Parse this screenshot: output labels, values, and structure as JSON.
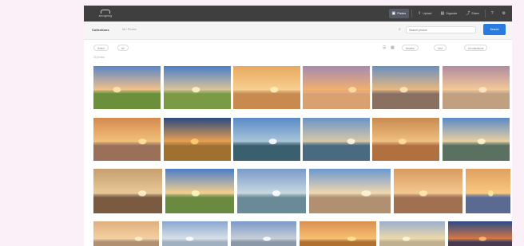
{
  "app": {
    "logo_text": "smugmug"
  },
  "nav": {
    "items": [
      {
        "label": "Photos",
        "icon": "image-icon",
        "active": true
      },
      {
        "label": "Upload",
        "icon": "upload-icon",
        "active": false
      },
      {
        "label": "Organize",
        "icon": "folder-icon",
        "active": false
      },
      {
        "label": "Share",
        "icon": "share-icon",
        "active": false
      }
    ]
  },
  "searchbar": {
    "collections_label": "Collections",
    "breadcrumb": "All / Photos",
    "search_placeholder": "Search photos",
    "search_button": "Search"
  },
  "toolbar": {
    "chip_left_1": "Select",
    "chip_left_2": "All",
    "sort_label": "Newest",
    "view_label": "Grid",
    "filter_label": "All collections"
  },
  "results": {
    "count_label": "24 photos"
  },
  "photos": [
    {
      "row": 1,
      "sky": "#5a86c8",
      "horizon": "#f2c089",
      "ground": "#6b8f3a",
      "sun": "#ffe9b0"
    },
    {
      "row": 1,
      "sky": "#4a7ec8",
      "horizon": "#d9c49a",
      "ground": "#7a9a45",
      "sun": "#fff4c8"
    },
    {
      "row": 1,
      "sky": "#e8a860",
      "horizon": "#f7d090",
      "ground": "#c98a50",
      "sun": "#fff0b8"
    },
    {
      "row": 1,
      "sky": "#a88ab0",
      "horizon": "#f0b070",
      "ground": "#d9a070",
      "sun": "#ffe0a8"
    },
    {
      "row": 1,
      "sky": "#6a90c0",
      "horizon": "#e8b880",
      "ground": "#8a7060",
      "sun": "#ffe8c0"
    },
    {
      "row": 1,
      "sky": "#b08ca0",
      "horizon": "#f4c898",
      "ground": "#c0a080",
      "sun": "#ffe8c8"
    },
    {
      "row": 2,
      "sky": "#d48a50",
      "horizon": "#f2c07a",
      "ground": "#9a7058",
      "sun": "#ffe6a0"
    },
    {
      "row": 2,
      "sky": "#2a4a80",
      "horizon": "#e8a050",
      "ground": "#a07030",
      "sun": "#ffd070"
    },
    {
      "row": 2,
      "sky": "#5a8ac8",
      "horizon": "#a8c4d8",
      "ground": "#3a6070",
      "sun": "#ffffff"
    },
    {
      "row": 2,
      "sky": "#6a94c8",
      "horizon": "#d8c8a8",
      "ground": "#4a6a80",
      "sun": "#fff8e0"
    },
    {
      "row": 2,
      "sky": "#c88a50",
      "horizon": "#f0c080",
      "ground": "#b07040",
      "sun": "#ffe0a0"
    },
    {
      "row": 2,
      "sky": "#5a8ac8",
      "horizon": "#e8d0a0",
      "ground": "#5a7060",
      "sun": "#fff6d0"
    },
    {
      "row": 3,
      "sky": "#c8a070",
      "horizon": "#e8c898",
      "ground": "#7a5a40",
      "sun": "#fff0c8"
    },
    {
      "row": 3,
      "sky": "#4a7ec8",
      "horizon": "#f4d090",
      "ground": "#6a8a40",
      "sun": "#fff8c0"
    },
    {
      "row": 3,
      "sky": "#7a9ac8",
      "horizon": "#c8d8e0",
      "ground": "#6a8a98",
      "sun": "#ffffff"
    },
    {
      "row": 3,
      "sky": "#6a98d0",
      "horizon": "#f0d8b0",
      "ground": "#b09070",
      "sun": "#fff6d8"
    },
    {
      "row": 3,
      "sky": "#d89a60",
      "horizon": "#f4c890",
      "ground": "#a07050",
      "sun": "#ffe8b0"
    },
    {
      "row": 3,
      "sky": "#e0a060",
      "horizon": "#f8c880",
      "ground": "#5a6a90",
      "sun": "#ffe8a0"
    },
    {
      "row": 4,
      "sky": "#e0b080",
      "horizon": "#f4d0a0",
      "ground": "#b09070",
      "sun": "#fff0c8"
    },
    {
      "row": 4,
      "sky": "#8aa8d0",
      "horizon": "#d8e0e8",
      "ground": "#a0b0c0",
      "sun": "#ffffff"
    },
    {
      "row": 4,
      "sky": "#7a9ac8",
      "horizon": "#c8d0d8",
      "ground": "#8a98a8",
      "sun": "#ffffff"
    },
    {
      "row": 4,
      "sky": "#d89050",
      "horizon": "#f8c070",
      "ground": "#b07030",
      "sun": "#ffe890"
    },
    {
      "row": 4,
      "sky": "#9ab0d0",
      "horizon": "#f0d8a8",
      "ground": "#c0b090",
      "sun": "#fff8d8"
    },
    {
      "row": 4,
      "sky": "#2a4a88",
      "horizon": "#d87840",
      "ground": "#4a3a50",
      "sun": "#ffc070"
    }
  ]
}
